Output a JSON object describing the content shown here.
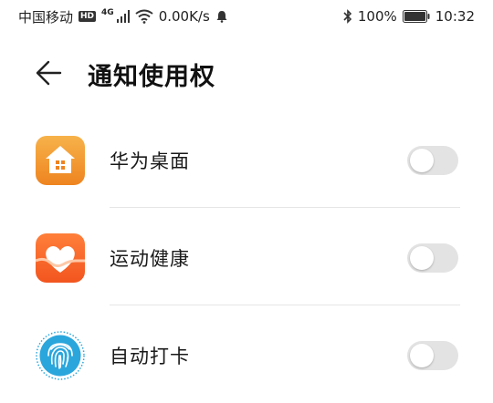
{
  "status_bar": {
    "carrier": "中国移动",
    "hd": "HD",
    "network": "4G",
    "speed": "0.00K/s",
    "battery_percent": "100%",
    "time": "10:32"
  },
  "header": {
    "title": "通知使用权"
  },
  "apps": [
    {
      "name": "华为桌面",
      "icon": "home-app-icon",
      "enabled": false
    },
    {
      "name": "运动健康",
      "icon": "health-app-icon",
      "enabled": false
    },
    {
      "name": "自动打卡",
      "icon": "fingerprint-app-icon",
      "enabled": false
    }
  ],
  "colors": {
    "home_icon_top": "#f7b24a",
    "home_icon_bottom": "#ee8420",
    "health_icon_top": "#ff7f3a",
    "health_icon_bottom": "#f2551f",
    "fingerprint_icon": "#2aa6dc",
    "toggle_off": "#e3e3e3"
  }
}
